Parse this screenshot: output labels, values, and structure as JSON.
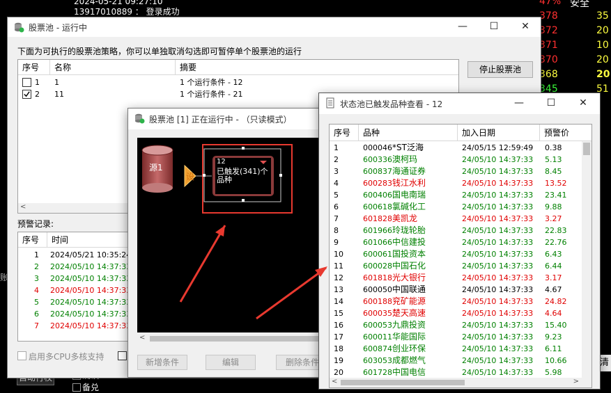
{
  "background": {
    "top_line1": "2024-05-21  09:27:10",
    "top_line2": "13917010889 ： 登录成功",
    "quotes": [
      {
        "a": "47%",
        "b": "安全",
        "ca": "#ff3030",
        "cb": "#ffffff"
      },
      {
        "a": "378",
        "b": "35",
        "ca": "#ff3030",
        "cb": "#ffff40"
      },
      {
        "a": "372",
        "b": "20",
        "ca": "#ff3030",
        "cb": "#ffff40"
      },
      {
        "a": "371",
        "b": "10",
        "ca": "#ff3030",
        "cb": "#ffff40"
      },
      {
        "a": "370",
        "b": "20",
        "ca": "#ff3030",
        "cb": "#ffff40"
      },
      {
        "a": "368",
        "b": "20",
        "ca": "#ffff40",
        "cb": "#ffff40"
      },
      {
        "a": "345",
        "b": "51",
        "ca": "#3cff3c",
        "cb": "#ffff40"
      }
    ],
    "auto_button": "自动行权",
    "confirm_label": "确认",
    "backup_label": "备兑",
    "left_letter": "账",
    "right_letter": "清"
  },
  "pool_window": {
    "title": "股票池 - 运行中",
    "instruction": "下面为可执行的股票池策略，你可以单独取消勾选即可暂停单个股票池的运行",
    "columns": [
      "序号",
      "名称",
      "摘要"
    ],
    "rows": [
      {
        "no": "1",
        "name": "1",
        "summary": "1 个运行条件 - 12",
        "checked": false
      },
      {
        "no": "2",
        "name": "11",
        "summary": "1 个运行条件 - 21",
        "checked": true
      }
    ],
    "stop_button": "停止股票池",
    "alert_label": "预警记录:",
    "alert_columns": [
      "序号",
      "时间"
    ],
    "alerts": [
      {
        "no": "1",
        "time": "2024/05/21 10:35:24",
        "color": "#000000"
      },
      {
        "no": "2",
        "time": "2024/05/10 14:37:33",
        "color": "#008000"
      },
      {
        "no": "3",
        "time": "2024/05/10 14:37:33",
        "color": "#008000"
      },
      {
        "no": "4",
        "time": "2024/05/10 14:37:33",
        "color": "#e00000"
      },
      {
        "no": "5",
        "time": "2024/05/10 14:37:33",
        "color": "#008000"
      },
      {
        "no": "6",
        "time": "2024/05/10 14:37:33",
        "color": "#008000"
      },
      {
        "no": "7",
        "time": "2024/05/10 14:37:33",
        "color": "#e00000"
      }
    ],
    "cpu_label": "启用多CPU多核支持"
  },
  "diagram_window": {
    "title": "股票池 [1] 正在运行中 - （只读模式）",
    "source_label": "源1",
    "set_label": "设",
    "node_id": "12",
    "node_text": "已触发(341)个品种",
    "buttons": [
      "新增条件",
      "编辑",
      "删除条件"
    ]
  },
  "triggered_window": {
    "title": "状态池已触发品种查看 - 12",
    "columns": [
      "序号",
      "品种",
      "加入日期",
      "预警价"
    ],
    "rows": [
      {
        "no": "1",
        "code": "000046",
        "name": "*ST泛海",
        "date": "24/05/15 12:59:49",
        "price": "0.38",
        "color": "#000000"
      },
      {
        "no": "2",
        "code": "600336",
        "name": "澳柯玛",
        "date": "24/05/10 14:37:33",
        "price": "5.13",
        "color": "#008000"
      },
      {
        "no": "3",
        "code": "600837",
        "name": "海通证券",
        "date": "24/05/10 14:37:33",
        "price": "8.45",
        "color": "#008000"
      },
      {
        "no": "4",
        "code": "600283",
        "name": "钱江水利",
        "date": "24/05/10 14:37:33",
        "price": "13.52",
        "color": "#e00000"
      },
      {
        "no": "5",
        "code": "600406",
        "name": "国电南瑞",
        "date": "24/05/10 14:37:33",
        "price": "23.41",
        "color": "#008000"
      },
      {
        "no": "6",
        "code": "600618",
        "name": "氯碱化工",
        "date": "24/05/10 14:37:33",
        "price": "9.88",
        "color": "#008000"
      },
      {
        "no": "7",
        "code": "601828",
        "name": "美凯龙",
        "date": "24/05/10 14:37:33",
        "price": "3.27",
        "color": "#e00000"
      },
      {
        "no": "8",
        "code": "601966",
        "name": "玲珑轮胎",
        "date": "24/05/10 14:37:33",
        "price": "22.83",
        "color": "#008000"
      },
      {
        "no": "9",
        "code": "601066",
        "name": "中信建投",
        "date": "24/05/10 14:37:33",
        "price": "22.76",
        "color": "#008000"
      },
      {
        "no": "10",
        "code": "600061",
        "name": "国投资本",
        "date": "24/05/10 14:37:33",
        "price": "6.43",
        "color": "#008000"
      },
      {
        "no": "11",
        "code": "600028",
        "name": "中国石化",
        "date": "24/05/10 14:37:33",
        "price": "6.44",
        "color": "#008000"
      },
      {
        "no": "12",
        "code": "601818",
        "name": "光大银行",
        "date": "24/05/10 14:37:33",
        "price": "3.17",
        "color": "#e00000"
      },
      {
        "no": "13",
        "code": "600050",
        "name": "中国联通",
        "date": "24/05/10 14:37:33",
        "price": "4.67",
        "color": "#000000"
      },
      {
        "no": "14",
        "code": "600188",
        "name": "兖矿能源",
        "date": "24/05/10 14:37:33",
        "price": "24.82",
        "color": "#e00000"
      },
      {
        "no": "15",
        "code": "600035",
        "name": "楚天高速",
        "date": "24/05/10 14:37:33",
        "price": "4.64",
        "color": "#e00000"
      },
      {
        "no": "16",
        "code": "600053",
        "name": "九鼎投资",
        "date": "24/05/10 14:37:33",
        "price": "15.40",
        "color": "#008000"
      },
      {
        "no": "17",
        "code": "600011",
        "name": "华能国际",
        "date": "24/05/10 14:37:33",
        "price": "9.23",
        "color": "#008000"
      },
      {
        "no": "18",
        "code": "600874",
        "name": "创业环保",
        "date": "24/05/10 14:37:33",
        "price": "6.11",
        "color": "#008000"
      },
      {
        "no": "19",
        "code": "603053",
        "name": "成都燃气",
        "date": "24/05/10 14:37:33",
        "price": "10.66",
        "color": "#008000"
      },
      {
        "no": "20",
        "code": "601728",
        "name": "中国电信",
        "date": "24/05/10 14:37:33",
        "price": "5.98",
        "color": "#008000"
      }
    ]
  },
  "colors": {
    "annotation_red": "#e8392f",
    "node_border": "#8b3a3a"
  }
}
